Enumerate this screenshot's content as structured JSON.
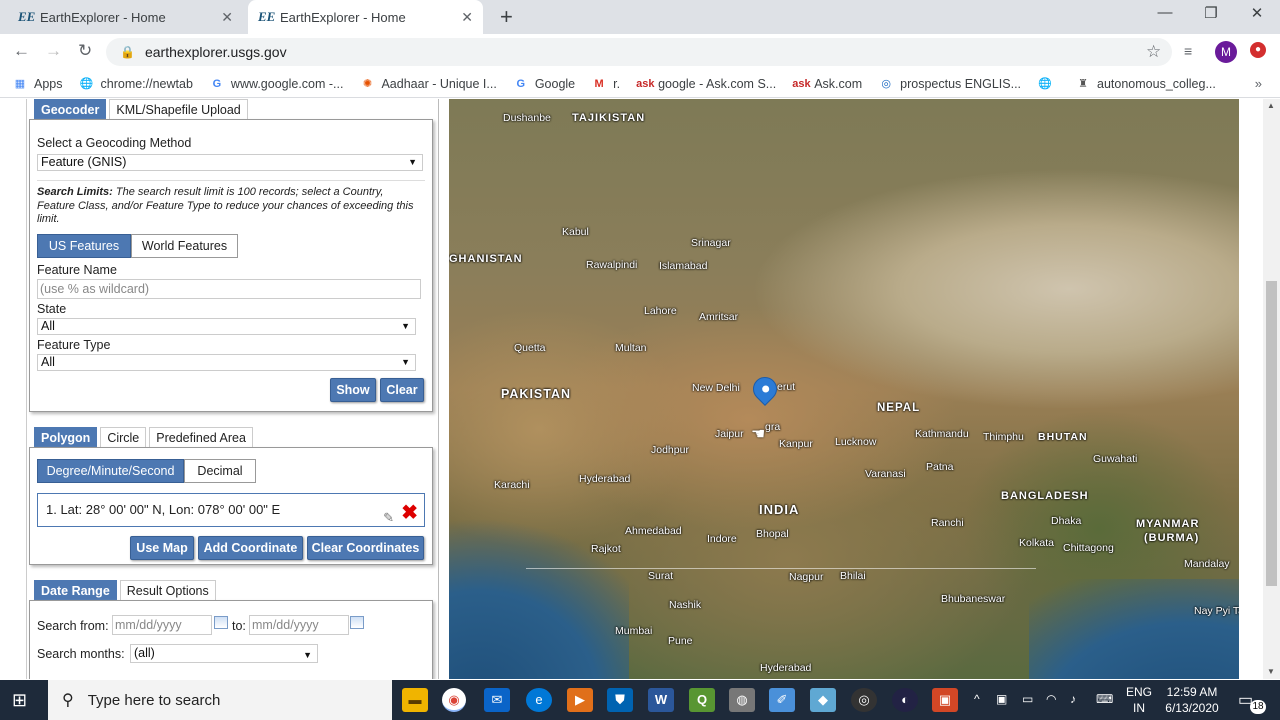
{
  "browser": {
    "tabs": [
      {
        "favicon": "EE",
        "title": "EarthExplorer - Home",
        "close": "✕"
      },
      {
        "favicon": "EE",
        "title": "EarthExplorer - Home",
        "close": "✕"
      }
    ],
    "new_tab": "+",
    "window_controls": {
      "minimize": "—",
      "restore": "❐",
      "close": "✕"
    },
    "nav": {
      "back": "←",
      "forward": "→",
      "reload": "↻"
    },
    "url": "earthexplorer.usgs.gov",
    "profile_initial": "M",
    "bookmarks": [
      {
        "label": "Apps",
        "icon": "apps-grid-icon"
      },
      {
        "label": "chrome://newtab",
        "icon": "globe-icon"
      },
      {
        "label": "www.google.com -...",
        "icon": "google-icon"
      },
      {
        "label": "Aadhaar - Unique I...",
        "icon": "aadhaar-icon"
      },
      {
        "label": "Google",
        "icon": "google-icon"
      },
      {
        "label": "r.",
        "icon": "gmail-icon"
      },
      {
        "label": "google - Ask.com S...",
        "icon": "ask-icon"
      },
      {
        "label": "Ask.com",
        "icon": "ask-icon"
      },
      {
        "label": "prospectus ENGLIS...",
        "icon": "prospectus-icon"
      },
      {
        "label": "",
        "icon": "globe-icon"
      },
      {
        "label": "autonomous_colleg...",
        "icon": "college-icon"
      }
    ],
    "bookmarks_more": "»"
  },
  "geocoder": {
    "tabs": [
      "Geocoder",
      "KML/Shapefile Upload"
    ],
    "method_label": "Select a Geocoding Method",
    "method_value": "Feature (GNIS)",
    "limits_bold": "Search Limits:",
    "limits_text": " The search result limit is 100 records; select a Country, Feature Class, and/or Feature Type to reduce your chances of exceeding this limit.",
    "feature_tabs": [
      "US Features",
      "World Features"
    ],
    "feature_name_label": "Feature Name",
    "feature_name_placeholder": "(use % as wildcard)",
    "state_label": "State",
    "state_value": "All",
    "feature_type_label": "Feature Type",
    "feature_type_value": "All",
    "show_button": "Show",
    "clear_button": "Clear"
  },
  "area": {
    "tabs": [
      "Polygon",
      "Circle",
      "Predefined Area"
    ],
    "format_tabs": [
      "Degree/Minute/Second",
      "Decimal"
    ],
    "coordinate": "1.  Lat: 28° 00' 00\" N, Lon: 078° 00' 00\" E",
    "use_map_button": "Use Map",
    "add_coordinate_button": "Add Coordinate",
    "clear_coordinates_button": "Clear Coordinates"
  },
  "date": {
    "tabs": [
      "Date Range",
      "Result Options"
    ],
    "search_from_label": "Search from:",
    "from_placeholder": "mm/dd/yyyy",
    "to_label": "to:",
    "to_placeholder": "mm/dd/yyyy",
    "months_label": "Search months:",
    "months_value": "(all)"
  },
  "map": {
    "labels": {
      "dushanbe": "Dushanbe",
      "tajikistan": "TAJIKISTAN",
      "kabul": "Kabul",
      "afghanistan": "GHANISTAN",
      "srinagar": "Srinagar",
      "rawalpindi": "Rawalpindi",
      "islamabad": "Islamabad",
      "lahore": "Lahore",
      "amritsar": "Amritsar",
      "quetta": "Quetta",
      "multan": "Multan",
      "pakistan": "PAKISTAN",
      "new_delhi": "New Delhi",
      "meerut": "erut",
      "agra": "gra",
      "jaipur": "Jaipur",
      "kanpur": "Kanpur",
      "lucknow": "Lucknow",
      "nepal": "NEPAL",
      "kathmandu": "Kathmandu",
      "thimphu": "Thimphu",
      "bhutan": "BHUTAN",
      "jodhpur": "Jodhpur",
      "varanasi": "Varanasi",
      "patna": "Patna",
      "guwahati": "Guwahati",
      "karachi": "Karachi",
      "hyderabad_pk": "Hyderabad",
      "india": "INDIA",
      "bangladesh": "BANGLADESH",
      "ahmedabad": "Ahmedabad",
      "indore": "Indore",
      "bhopal": "Bhopal",
      "ranchi": "Ranchi",
      "dhaka": "Dhaka",
      "myanmar": "MYANMAR",
      "burma": "(BURMA)",
      "rajkot": "Rajkot",
      "kolkata": "Kolkata",
      "chittagong": "Chittagong",
      "mandalay": "Mandalay",
      "surat": "Surat",
      "nagpur": "Nagpur",
      "bhilai": "Bhilai",
      "nashik": "Nashik",
      "bhubaneswar": "Bhubaneswar",
      "nay_pyi_ta": "Nay Pyi Ta",
      "mumbai": "Mumbai",
      "pune": "Pune",
      "hyderabad_in": "Hyderabad"
    }
  },
  "taskbar": {
    "search_placeholder": "Type here to search",
    "lang_top": "ENG",
    "lang_bottom": "IN",
    "time": "12:59 AM",
    "date": "6/13/2020",
    "notifications": "18"
  }
}
